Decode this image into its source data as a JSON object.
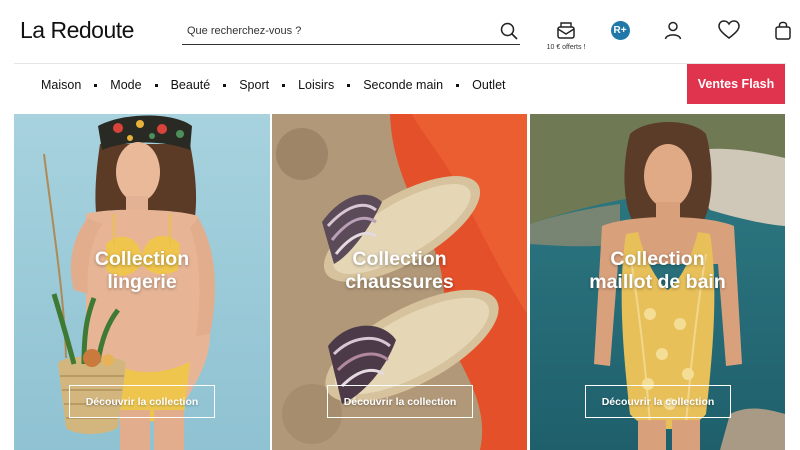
{
  "header": {
    "logo": "La Redoute",
    "search_placeholder": "Que recherchez-vous ?",
    "offers_label": "10 € offerts !",
    "rplus_label": "R+",
    "icons": [
      "search-icon",
      "offers-mail-icon",
      "rplus-icon",
      "account-icon",
      "wishlist-heart-icon",
      "cart-bag-icon"
    ]
  },
  "nav": {
    "items": [
      "Maison",
      "Mode",
      "Beauté",
      "Sport",
      "Loisirs",
      "Seconde main",
      "Outlet"
    ],
    "flash_label": "Ventes Flash",
    "flash_color": "#e0334e"
  },
  "cards": [
    {
      "title_line1": "Collection",
      "title_line2": "lingerie",
      "button": "Découvrir la collection"
    },
    {
      "title_line1": "Collection",
      "title_line2": "chaussures",
      "button": "Découvrir la collection"
    },
    {
      "title_line1": "Collection",
      "title_line2": "maillot de bain",
      "button": "Découvrir la collection"
    }
  ]
}
